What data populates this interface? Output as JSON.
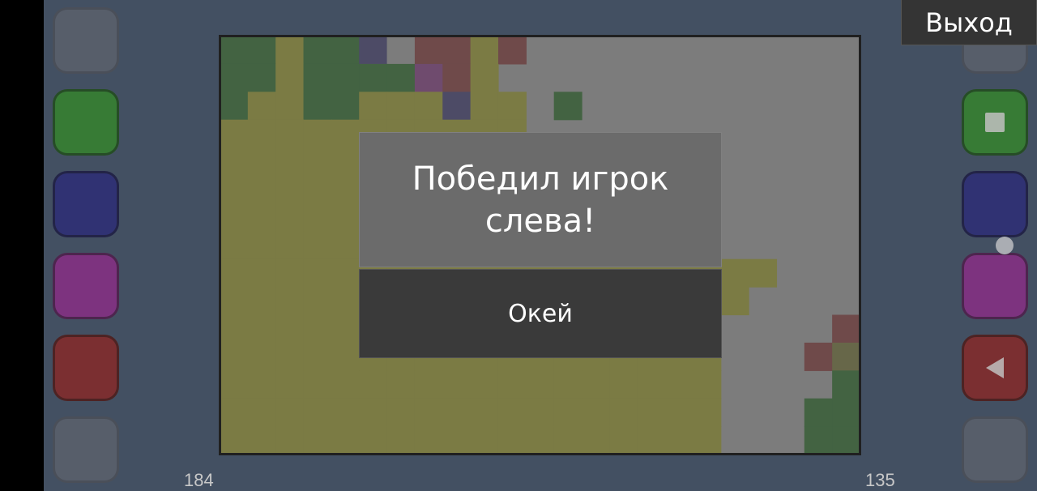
{
  "exit_label": "Выход",
  "dialog": {
    "message": "Победил игрок слева!",
    "ok_label": "Окей"
  },
  "scores": {
    "left": "184",
    "right": "135"
  },
  "palette": {
    "green": "#2f8a2c",
    "blue": "#26297f",
    "magenta": "#8c2a8f",
    "red": "#8a2527",
    "inactive": "#5a6373",
    "olive": "#8a8a40",
    "dark_green": "#3f6a3e",
    "gray": "#8b8b8b",
    "board_dark_green": "#436a40",
    "board_navy": "#4d4a6e",
    "board_maroon": "#7a4848",
    "board_purple": "#7a4a78",
    "board_khaki": "#6f6f47"
  },
  "left_buttons": [
    {
      "name": "left-inactive-top",
      "color": "inactive",
      "active": false
    },
    {
      "name": "left-green",
      "color": "green",
      "active": true
    },
    {
      "name": "left-blue",
      "color": "blue",
      "active": true
    },
    {
      "name": "left-magenta",
      "color": "magenta",
      "active": true
    },
    {
      "name": "left-red",
      "color": "red",
      "active": true
    },
    {
      "name": "left-inactive-bottom",
      "color": "inactive",
      "active": false
    }
  ],
  "right_buttons": [
    {
      "name": "right-inactive-top",
      "color": "inactive",
      "active": false
    },
    {
      "name": "right-green",
      "color": "green",
      "active": true,
      "icon": "stop-square-icon"
    },
    {
      "name": "right-blue",
      "color": "blue",
      "active": true
    },
    {
      "name": "right-magenta",
      "color": "magenta",
      "active": true
    },
    {
      "name": "right-red",
      "color": "red",
      "active": true,
      "icon": "back-triangle-icon"
    },
    {
      "name": "right-inactive-bottom",
      "color": "inactive",
      "active": false
    }
  ],
  "board": {
    "cols": 23,
    "rows": 15,
    "base_color": "gray",
    "cells": [
      [
        "dark_green",
        0,
        0
      ],
      [
        "dark_green",
        1,
        0
      ],
      [
        "olive",
        2,
        0
      ],
      [
        "dark_green",
        3,
        0
      ],
      [
        "dark_green",
        4,
        0
      ],
      [
        "board_navy",
        5,
        0
      ],
      [
        "gray",
        6,
        0
      ],
      [
        "board_maroon",
        7,
        0
      ],
      [
        "board_maroon",
        8,
        0
      ],
      [
        "olive",
        9,
        0
      ],
      [
        "board_maroon",
        10,
        0
      ],
      [
        "dark_green",
        0,
        1
      ],
      [
        "dark_green",
        1,
        1
      ],
      [
        "olive",
        2,
        1
      ],
      [
        "dark_green",
        3,
        1
      ],
      [
        "dark_green",
        4,
        1
      ],
      [
        "dark_green",
        5,
        1
      ],
      [
        "dark_green",
        6,
        1
      ],
      [
        "board_purple",
        7,
        1
      ],
      [
        "board_maroon",
        8,
        1
      ],
      [
        "olive",
        9,
        1
      ],
      [
        "dark_green",
        0,
        2
      ],
      [
        "olive",
        1,
        2
      ],
      [
        "olive",
        2,
        2
      ],
      [
        "dark_green",
        3,
        2
      ],
      [
        "dark_green",
        4,
        2
      ],
      [
        "olive",
        5,
        2
      ],
      [
        "olive",
        6,
        2
      ],
      [
        "olive",
        7,
        2
      ],
      [
        "board_navy",
        8,
        2
      ],
      [
        "olive",
        9,
        2
      ],
      [
        "olive",
        10,
        2
      ],
      [
        "dark_green",
        12,
        2
      ],
      [
        "olive",
        0,
        3
      ],
      [
        "olive",
        1,
        3
      ],
      [
        "olive",
        2,
        3
      ],
      [
        "olive",
        3,
        3
      ],
      [
        "olive",
        4,
        3
      ],
      [
        "olive",
        5,
        3
      ],
      [
        "olive",
        6,
        3
      ],
      [
        "olive",
        7,
        3
      ],
      [
        "olive",
        8,
        3
      ],
      [
        "olive",
        9,
        3
      ],
      [
        "olive",
        10,
        3
      ],
      [
        "olive",
        0,
        4
      ],
      [
        "olive",
        1,
        4
      ],
      [
        "olive",
        2,
        4
      ],
      [
        "olive",
        3,
        4
      ],
      [
        "olive",
        4,
        4
      ],
      [
        "olive",
        5,
        4
      ],
      [
        "olive",
        6,
        4
      ],
      [
        "olive",
        7,
        4
      ],
      [
        "olive",
        8,
        4
      ],
      [
        "olive",
        9,
        4
      ],
      [
        "olive",
        10,
        4
      ],
      [
        "olive",
        0,
        5
      ],
      [
        "olive",
        1,
        5
      ],
      [
        "olive",
        2,
        5
      ],
      [
        "olive",
        3,
        5
      ],
      [
        "olive",
        4,
        5
      ],
      [
        "olive",
        5,
        5
      ],
      [
        "olive",
        6,
        5
      ],
      [
        "olive",
        7,
        5
      ],
      [
        "olive",
        8,
        5
      ],
      [
        "olive",
        9,
        5
      ],
      [
        "olive",
        10,
        5
      ],
      [
        "olive",
        0,
        6
      ],
      [
        "olive",
        1,
        6
      ],
      [
        "olive",
        2,
        6
      ],
      [
        "olive",
        3,
        6
      ],
      [
        "olive",
        4,
        6
      ],
      [
        "olive",
        5,
        6
      ],
      [
        "olive",
        6,
        6
      ],
      [
        "olive",
        7,
        6
      ],
      [
        "olive",
        8,
        6
      ],
      [
        "olive",
        9,
        6
      ],
      [
        "olive",
        10,
        6
      ],
      [
        "olive",
        0,
        7
      ],
      [
        "olive",
        1,
        7
      ],
      [
        "olive",
        2,
        7
      ],
      [
        "olive",
        3,
        7
      ],
      [
        "olive",
        4,
        7
      ],
      [
        "olive",
        5,
        7
      ],
      [
        "olive",
        6,
        7
      ],
      [
        "olive",
        7,
        7
      ],
      [
        "olive",
        8,
        7
      ],
      [
        "olive",
        9,
        7
      ],
      [
        "olive",
        10,
        7
      ],
      [
        "olive",
        0,
        8
      ],
      [
        "olive",
        1,
        8
      ],
      [
        "olive",
        2,
        8
      ],
      [
        "olive",
        3,
        8
      ],
      [
        "olive",
        4,
        8
      ],
      [
        "olive",
        5,
        8
      ],
      [
        "olive",
        6,
        8
      ],
      [
        "olive",
        7,
        8
      ],
      [
        "olive",
        8,
        8
      ],
      [
        "olive",
        9,
        8
      ],
      [
        "olive",
        10,
        8
      ],
      [
        "olive",
        11,
        8
      ],
      [
        "olive",
        12,
        8
      ],
      [
        "olive",
        13,
        8
      ],
      [
        "olive",
        14,
        8
      ],
      [
        "olive",
        15,
        8
      ],
      [
        "olive",
        16,
        8
      ],
      [
        "olive",
        17,
        8
      ],
      [
        "olive",
        18,
        8
      ],
      [
        "olive",
        19,
        8
      ],
      [
        "olive",
        0,
        9
      ],
      [
        "olive",
        1,
        9
      ],
      [
        "olive",
        2,
        9
      ],
      [
        "olive",
        3,
        9
      ],
      [
        "olive",
        4,
        9
      ],
      [
        "olive",
        5,
        9
      ],
      [
        "olive",
        6,
        9
      ],
      [
        "olive",
        7,
        9
      ],
      [
        "olive",
        8,
        9
      ],
      [
        "olive",
        9,
        9
      ],
      [
        "olive",
        10,
        9
      ],
      [
        "olive",
        11,
        9
      ],
      [
        "olive",
        12,
        9
      ],
      [
        "olive",
        13,
        9
      ],
      [
        "olive",
        14,
        9
      ],
      [
        "olive",
        15,
        9
      ],
      [
        "olive",
        16,
        9
      ],
      [
        "olive",
        17,
        9
      ],
      [
        "olive",
        18,
        9
      ],
      [
        "olive",
        0,
        10
      ],
      [
        "olive",
        1,
        10
      ],
      [
        "olive",
        2,
        10
      ],
      [
        "olive",
        3,
        10
      ],
      [
        "olive",
        4,
        10
      ],
      [
        "olive",
        5,
        10
      ],
      [
        "olive",
        6,
        10
      ],
      [
        "olive",
        7,
        10
      ],
      [
        "olive",
        8,
        10
      ],
      [
        "olive",
        9,
        10
      ],
      [
        "olive",
        10,
        10
      ],
      [
        "olive",
        11,
        10
      ],
      [
        "olive",
        12,
        10
      ],
      [
        "olive",
        13,
        10
      ],
      [
        "olive",
        14,
        10
      ],
      [
        "olive",
        15,
        10
      ],
      [
        "olive",
        16,
        10
      ],
      [
        "olive",
        17,
        10
      ],
      [
        "board_maroon",
        22,
        10
      ],
      [
        "olive",
        0,
        11
      ],
      [
        "olive",
        1,
        11
      ],
      [
        "olive",
        2,
        11
      ],
      [
        "olive",
        3,
        11
      ],
      [
        "olive",
        4,
        11
      ],
      [
        "olive",
        5,
        11
      ],
      [
        "olive",
        6,
        11
      ],
      [
        "olive",
        7,
        11
      ],
      [
        "olive",
        8,
        11
      ],
      [
        "olive",
        9,
        11
      ],
      [
        "olive",
        10,
        11
      ],
      [
        "olive",
        11,
        11
      ],
      [
        "olive",
        12,
        11
      ],
      [
        "olive",
        13,
        11
      ],
      [
        "olive",
        14,
        11
      ],
      [
        "olive",
        15,
        11
      ],
      [
        "olive",
        16,
        11
      ],
      [
        "olive",
        17,
        11
      ],
      [
        "board_maroon",
        21,
        11
      ],
      [
        "board_khaki",
        22,
        11
      ],
      [
        "olive",
        0,
        12
      ],
      [
        "olive",
        1,
        12
      ],
      [
        "olive",
        2,
        12
      ],
      [
        "olive",
        3,
        12
      ],
      [
        "olive",
        4,
        12
      ],
      [
        "olive",
        5,
        12
      ],
      [
        "olive",
        6,
        12
      ],
      [
        "olive",
        7,
        12
      ],
      [
        "olive",
        8,
        12
      ],
      [
        "olive",
        9,
        12
      ],
      [
        "olive",
        10,
        12
      ],
      [
        "olive",
        11,
        12
      ],
      [
        "olive",
        12,
        12
      ],
      [
        "olive",
        13,
        12
      ],
      [
        "olive",
        14,
        12
      ],
      [
        "olive",
        15,
        12
      ],
      [
        "olive",
        16,
        12
      ],
      [
        "olive",
        17,
        12
      ],
      [
        "dark_green",
        22,
        12
      ],
      [
        "olive",
        0,
        13
      ],
      [
        "olive",
        1,
        13
      ],
      [
        "olive",
        2,
        13
      ],
      [
        "olive",
        3,
        13
      ],
      [
        "olive",
        4,
        13
      ],
      [
        "olive",
        5,
        13
      ],
      [
        "olive",
        6,
        13
      ],
      [
        "olive",
        7,
        13
      ],
      [
        "olive",
        8,
        13
      ],
      [
        "olive",
        9,
        13
      ],
      [
        "olive",
        10,
        13
      ],
      [
        "olive",
        11,
        13
      ],
      [
        "olive",
        12,
        13
      ],
      [
        "olive",
        13,
        13
      ],
      [
        "olive",
        14,
        13
      ],
      [
        "olive",
        15,
        13
      ],
      [
        "olive",
        16,
        13
      ],
      [
        "olive",
        17,
        13
      ],
      [
        "dark_green",
        21,
        13
      ],
      [
        "dark_green",
        22,
        13
      ],
      [
        "olive",
        0,
        14
      ],
      [
        "olive",
        1,
        14
      ],
      [
        "olive",
        2,
        14
      ],
      [
        "olive",
        3,
        14
      ],
      [
        "olive",
        4,
        14
      ],
      [
        "olive",
        5,
        14
      ],
      [
        "olive",
        6,
        14
      ],
      [
        "olive",
        7,
        14
      ],
      [
        "olive",
        8,
        14
      ],
      [
        "olive",
        9,
        14
      ],
      [
        "olive",
        10,
        14
      ],
      [
        "olive",
        11,
        14
      ],
      [
        "olive",
        12,
        14
      ],
      [
        "olive",
        13,
        14
      ],
      [
        "olive",
        14,
        14
      ],
      [
        "olive",
        15,
        14
      ],
      [
        "olive",
        16,
        14
      ],
      [
        "olive",
        17,
        14
      ],
      [
        "dark_green",
        21,
        14
      ],
      [
        "dark_green",
        22,
        14
      ]
    ]
  }
}
